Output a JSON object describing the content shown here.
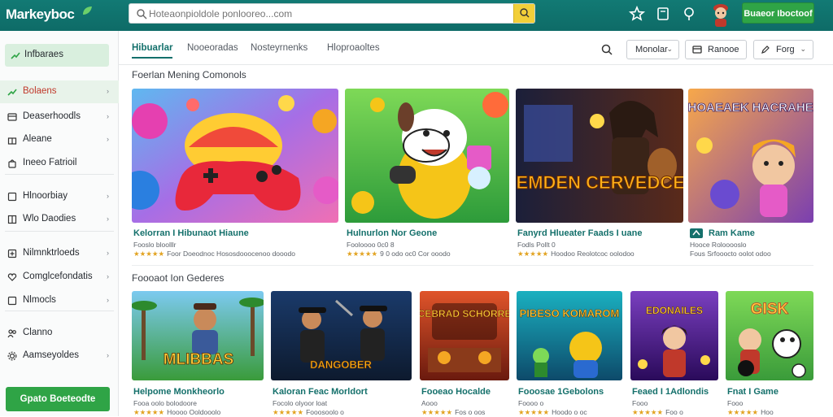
{
  "header": {
    "app_name": "Markeyboc",
    "search_placeholder": "Hoteaonpioldole ponlooreo...com",
    "signin_label": "Buaeor Iboctoof",
    "icons": [
      "star-badge-icon",
      "book-icon",
      "pin-icon",
      "avatar-icon"
    ],
    "colors": {
      "bar": "#127a74",
      "search_btn": "#f2cf39",
      "cta": "#2fa446"
    }
  },
  "sidebar": {
    "top_label": "Infbaraes",
    "items": [
      {
        "label": "Bolaens",
        "icon": "trend-icon",
        "active": true,
        "chevron": true
      },
      {
        "label": "Deaserhoodls",
        "icon": "box-icon",
        "chevron": true
      },
      {
        "label": "Aleane",
        "icon": "gift-icon",
        "chevron": true
      },
      {
        "label": "Ineeo Fatrioil",
        "icon": "bag-icon",
        "chevron": false
      },
      {
        "label": "Hlnoorbiay",
        "icon": "square-icon",
        "chevron": true
      },
      {
        "label": "Wlo Daodies",
        "icon": "grid-icon",
        "chevron": true
      },
      {
        "label": "Nilmnktrloeds",
        "icon": "plus-icon",
        "chevron": true
      },
      {
        "label": "Comglcefondatis",
        "icon": "heart-icon",
        "chevron": true
      },
      {
        "label": "Nlmocls",
        "icon": "square-icon",
        "chevron": true
      },
      {
        "label": "Clanno",
        "icon": "people-icon",
        "chevron": false
      },
      {
        "label": "Aamseyoldes",
        "icon": "gear-icon",
        "chevron": true
      }
    ],
    "cta_label": "Gpato Boeteodte"
  },
  "tabs": {
    "items": [
      {
        "label": "Hibuarlar",
        "active": true
      },
      {
        "label": "Nooeoradas",
        "active": false
      },
      {
        "label": "Nosteyrnenks",
        "active": false
      },
      {
        "label": "Hloproaoltes",
        "active": false
      }
    ],
    "pills": [
      {
        "label": "Monolar",
        "icon": "chevron-down-icon"
      },
      {
        "label": "Ranooe",
        "icon": "card-icon"
      },
      {
        "label": "Forg",
        "icon": "pen-icon"
      }
    ]
  },
  "section1": {
    "title": "Foerlan Mening Comonols",
    "cards": [
      {
        "title": "Kelorran I Hibunaot Hiaune",
        "meta": "Fooslo bloolllr",
        "rating_tail": "Foor Doeodnoc Hososdooocenoo dooodo"
      },
      {
        "title": "Hulnurlon Nor Geone",
        "meta": "Fooloooo 0c0 8",
        "rating_tail": "9 0 odo oc0 Cor ooodo"
      },
      {
        "title": "Fanyrd Hlueater Faads I uane",
        "meta": "Fodls Pollt 0",
        "rating_tail": "Hoodoo Reolotcoc oolodoo"
      },
      {
        "title": "Ram Kame",
        "meta": "Hooce Rolooooslo",
        "rating_tail": "Fous Srfooocto oolot odoo"
      }
    ]
  },
  "section2": {
    "title": "Foooaot Ion Gederes",
    "cards": [
      {
        "title": "Helpome Monkheorlo",
        "meta": "Fooa oolo bolodoore",
        "rating_tail": "Hoooo Ooldooolo"
      },
      {
        "title": "Kaloran Feac Morldort",
        "meta": "Focolo olyoor loat",
        "rating_tail": "Fooosoolo o"
      },
      {
        "title": "Fooeao Hocalde",
        "meta": "Aooo",
        "rating_tail": "Fos o oos"
      },
      {
        "title": "Fooosae 1Gebolons",
        "meta": "Foooo o",
        "rating_tail": "Hoodo o oc"
      },
      {
        "title": "Feaed I 1Adlondis",
        "meta": "Fooo",
        "rating_tail": "Foo o"
      },
      {
        "title": "Fnat I Game",
        "meta": "Fooo",
        "rating_tail": "Hoo"
      }
    ]
  },
  "artwork_text": {
    "card3_banner": "GEMDEN CERVEDCES",
    "card4_banner": "EHOAEAEK HACRAHEN",
    "s2_card1_banner": "MLIBBAS",
    "s2_card2_banner": "DANGOBER",
    "s2_card3_banner": "CEBRAD SCHORRE",
    "s2_card4_banner": "PIBESO KOMAROM",
    "s2_card5_banner": "EDONAILES",
    "s2_card6_banner": "GISK"
  }
}
